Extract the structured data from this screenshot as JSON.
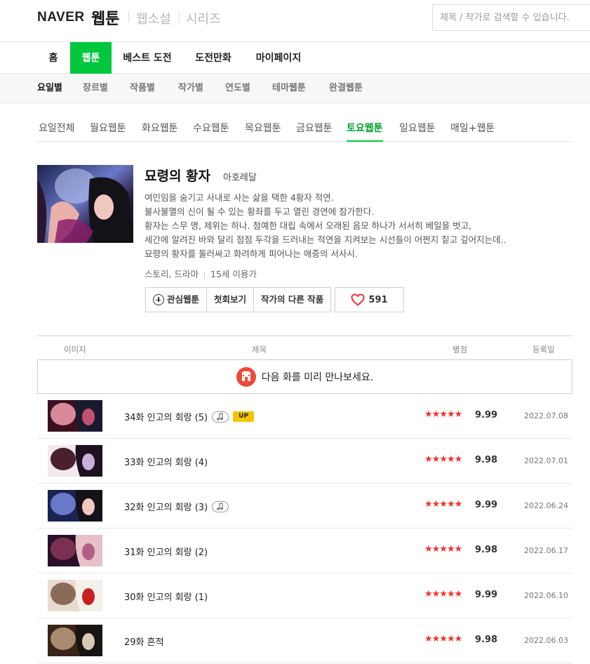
{
  "header": {
    "logo": "NAVER",
    "service_active": "웹툰",
    "services": [
      "웹소설",
      "시리즈"
    ],
    "search_placeholder": "제목 / 작가로 검색할 수 있습니다."
  },
  "main_nav": [
    "홈",
    "웹툰",
    "베스트 도전",
    "도전만화",
    "마이페이지"
  ],
  "main_nav_active": 1,
  "sub_nav": [
    "요일별",
    "장르별",
    "작품별",
    "작가별",
    "연도별",
    "테마웹툰",
    "완결웹툰"
  ],
  "sub_nav_active": 0,
  "day_tabs": [
    "요일전체",
    "월요웹툰",
    "화요웹툰",
    "수요웹툰",
    "목요웹툰",
    "금요웹툰",
    "토요웹툰",
    "일요웹툰",
    "매일+웹툰"
  ],
  "day_tabs_active": 6,
  "comic": {
    "title": "묘령의 황자",
    "author": "아호레달",
    "description": [
      "여인임을 숨기고 사내로 사는 삶을 택한 4황자 적연.",
      "불사불멸의 신이 될 수 있는 황좌를 두고 열린 경연에 참가한다.",
      "황자는 스무 명, 제위는 하나. 첨예한 대립 속에서 오래된 음모 하나가 서서히 베일을 벗고,",
      "세간에 알려진 바와 달리 점점 두각을 드러내는 적연을 지켜보는 시선들이 어쩐지 짙고 깊어지는데..",
      "묘령의 황자를 둘러싸고 화려하게 피어나는 애증의 서사시."
    ],
    "genre": "스토리, 드라마",
    "age": "15세 이용가",
    "buttons": {
      "interest": "관심웹툰",
      "first": "첫회보기",
      "other_works": "작가의 다른 작품"
    },
    "likes": "591"
  },
  "list_header": {
    "image": "이미지",
    "title": "제목",
    "rating": "별점",
    "date": "등록일"
  },
  "preview_text": "다음 화를 미리 만나보세요.",
  "episodes": [
    {
      "title": "34화 인고의 회랑 (5)",
      "music": true,
      "up": true,
      "stars": "★★★★★",
      "score": "9.99",
      "date": "2022.07.08"
    },
    {
      "title": "33화 인고의 회랑 (4)",
      "music": false,
      "up": false,
      "stars": "★★★★★",
      "score": "9.98",
      "date": "2022.07.01"
    },
    {
      "title": "32화 인고의 회랑 (3)",
      "music": true,
      "up": false,
      "stars": "★★★★★",
      "score": "9.99",
      "date": "2022.06.24"
    },
    {
      "title": "31화 인고의 회랑 (2)",
      "music": false,
      "up": false,
      "stars": "★★★★★",
      "score": "9.98",
      "date": "2022.06.17"
    },
    {
      "title": "30화 인고의 회랑 (1)",
      "music": false,
      "up": false,
      "stars": "★★★★★",
      "score": "9.99",
      "date": "2022.06.10"
    },
    {
      "title": "29화 흔적",
      "music": false,
      "up": false,
      "stars": "★★★★★",
      "score": "9.98",
      "date": "2022.06.03"
    }
  ],
  "up_label": "UP"
}
